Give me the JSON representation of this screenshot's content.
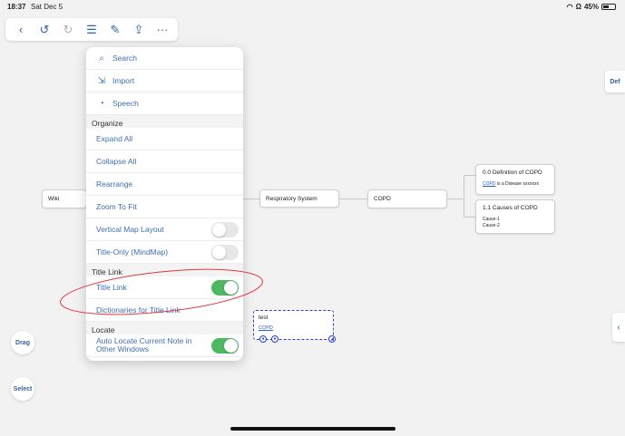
{
  "status_bar": {
    "time": "18:37",
    "date": "Sat Dec 5",
    "battery": "45%"
  },
  "toolbar": {
    "buttons": [
      {
        "name": "back",
        "icon": "chevron-left-icon",
        "glyph": "‹"
      },
      {
        "name": "undo",
        "icon": "undo-icon",
        "glyph": "↺"
      },
      {
        "name": "redo",
        "icon": "redo-icon",
        "glyph": "↻"
      },
      {
        "name": "list",
        "icon": "list-icon",
        "glyph": "☰"
      },
      {
        "name": "edit",
        "icon": "edit-icon",
        "glyph": "✎"
      },
      {
        "name": "share",
        "icon": "share-icon",
        "glyph": "⇪"
      },
      {
        "name": "more",
        "icon": "more-icon",
        "glyph": "···"
      }
    ]
  },
  "menu": {
    "search": "Search",
    "import": "Import",
    "speech": "Speech",
    "organize_header": "Organize",
    "expand_all": "Expand All",
    "collapse_all": "Collapse All",
    "rearrange": "Rearrange",
    "zoom_to_fit": "Zoom To Fit",
    "vertical_map_layout": "Vertical Map Layout",
    "title_only": "Title-Only (MindMap)",
    "title_link_header": "Title Link",
    "title_link": "Title Link",
    "dictionaries": "Dictionaries for Title Link",
    "locate_header": "Locate",
    "auto_locate": "Auto Locate Current Note in Other Windows"
  },
  "mindmap": {
    "wiki": "Wiki",
    "respiratory": "Respiratory System",
    "copd": "COPD",
    "def_title": "0.0 Definition of COPD",
    "def_link": "COPD",
    "def_text": " is a Disease xxxxxxx",
    "causes_title": "1.1 Causes of COPD",
    "cause1": "Cause-1",
    "cause2": "Cause-2",
    "test_title": "test",
    "test_link": "COPD"
  },
  "side": {
    "drag": "Drag",
    "select": "Select",
    "def": "Def"
  },
  "colors": {
    "accent": "#3e6fb0",
    "toggle_on": "#4cb860",
    "annotation": "#e0393e"
  }
}
